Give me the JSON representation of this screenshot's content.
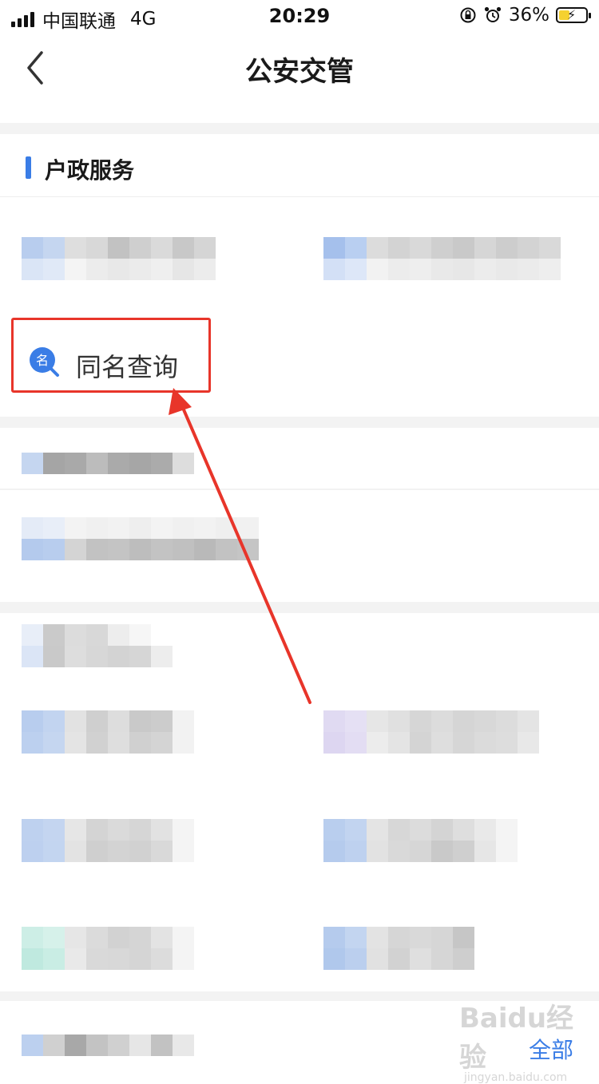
{
  "status_bar": {
    "carrier": "中国联通",
    "network": "4G",
    "time": "20:29",
    "battery": "36%",
    "battery_level": 0.36
  },
  "nav": {
    "title": "公安交管",
    "back_icon": "chevron-left-icon"
  },
  "section": {
    "title": "户政服务",
    "accent_color": "#3a7de6"
  },
  "highlight": {
    "label": "同名查询",
    "icon_text": "名",
    "icon": "name-search-icon",
    "box_color": "#e8352a",
    "arrow_color": "#e8352a"
  },
  "footer": {
    "all_label": "全部"
  },
  "watermark": {
    "brand": "Baidu经验",
    "url": "jingyan.baidu.com"
  }
}
